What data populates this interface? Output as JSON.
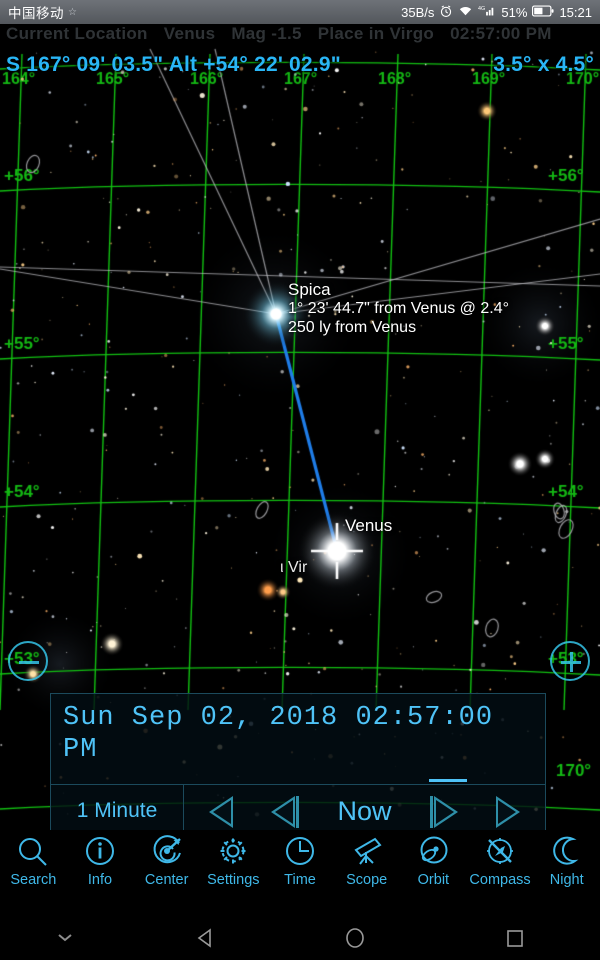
{
  "statusbar": {
    "carrier": "中国移动",
    "net_speed": "35B/s",
    "alarm_icon": "alarm-clock-icon",
    "wifi_icon": "wifi-icon",
    "signal_icon": "signal-4g-icon",
    "battery_pct": "51%",
    "battery_icon": "battery-icon",
    "clock": "15:21"
  },
  "faded_header": {
    "location": "Current Location",
    "object": "Venus",
    "magnitude": "Mag -1.5",
    "place": "Place in Virgo",
    "time": "02:57:00 PM"
  },
  "readout": {
    "coords": "S 167° 09' 03.5\" Alt +54° 22' 02.9\"",
    "fov": "3.5° x 4.5°"
  },
  "grid": {
    "ra_labels": [
      "164°",
      "165°",
      "166°",
      "167°",
      "168°",
      "169°",
      "170°"
    ],
    "dec_labels_left": [
      "+56°",
      "+55°",
      "+54°",
      "+53°"
    ],
    "dec_labels_right": [
      "+56°",
      "+55°",
      "+54°",
      "+53°"
    ],
    "corner_label": "170°",
    "grid_color": "#12c212"
  },
  "objects": {
    "spica": {
      "name": "Spica",
      "separation": "1° 23' 44.7\" from Venus @ 2.4°",
      "distance": "250 ly from Venus"
    },
    "venus": {
      "name": "Venus"
    },
    "iota_vir": {
      "name": "ι Vir"
    }
  },
  "zoom_controls": {
    "zoom_out_icon": "zoom-out-icon",
    "zoom_in_icon": "zoom-in-icon"
  },
  "time_panel": {
    "datetime": "Sun Sep 02, 2018  02:57:00 PM",
    "step": "1 Minute",
    "now_label": "Now",
    "rewind_icon": "rewind-icon",
    "step_back_icon": "step-back-icon",
    "step_forward_icon": "step-forward-icon",
    "fast_forward_icon": "fast-forward-icon"
  },
  "toolbar": {
    "items": [
      {
        "label": "Search",
        "icon": "search-icon"
      },
      {
        "label": "Info",
        "icon": "info-icon"
      },
      {
        "label": "Center",
        "icon": "center-target-icon"
      },
      {
        "label": "Settings",
        "icon": "gear-icon"
      },
      {
        "label": "Time",
        "icon": "clock-icon"
      },
      {
        "label": "Scope",
        "icon": "telescope-icon"
      },
      {
        "label": "Orbit",
        "icon": "orbit-icon"
      },
      {
        "label": "Compass",
        "icon": "compass-off-icon"
      },
      {
        "label": "Night",
        "icon": "moon-icon"
      }
    ],
    "accent_color": "#3fb8e8"
  },
  "navbar": {
    "hide_icon": "chevron-down-icon",
    "back_icon": "back-triangle-icon",
    "home_icon": "home-circle-icon",
    "recents_icon": "recents-square-icon"
  }
}
